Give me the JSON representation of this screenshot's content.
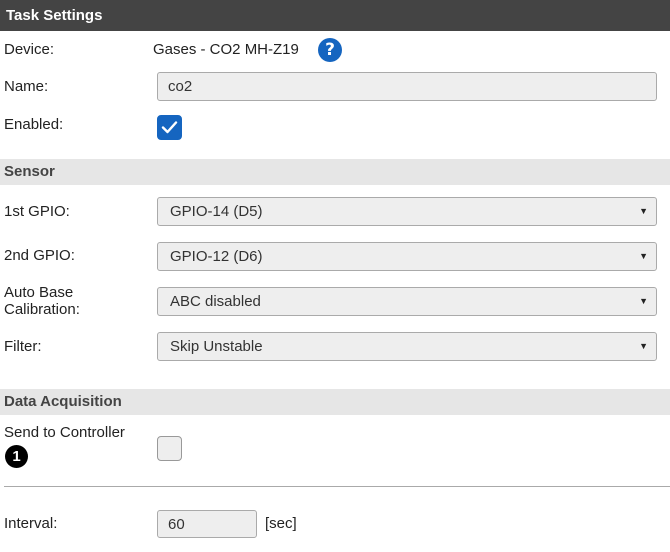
{
  "title": "Task Settings",
  "device": {
    "label": "Device:",
    "value": "Gases - CO2 MH-Z19",
    "help_icon": "?"
  },
  "name": {
    "label": "Name:",
    "value": "co2"
  },
  "enabled": {
    "label": "Enabled:",
    "checked": true
  },
  "sensor_section": {
    "title": "Sensor",
    "gpio1": {
      "label": "1st GPIO:",
      "selected": "GPIO-14 (D5)"
    },
    "gpio2": {
      "label": "2nd GPIO:",
      "selected": "GPIO-12 (D6)"
    },
    "abc": {
      "label_line1": "Auto Base",
      "label_line2": "Calibration:",
      "selected": "ABC disabled"
    },
    "filter": {
      "label": "Filter:",
      "selected": "Skip Unstable"
    }
  },
  "data_section": {
    "title": "Data Acquisition",
    "send_label": "Send to Controller",
    "controller_number": "1",
    "send_checked": false,
    "interval_label": "Interval:",
    "interval_value": "60",
    "interval_unit": "[sec]"
  },
  "icons": {
    "help": "help-icon",
    "check": "checkmark-icon",
    "dropdown": "dropdown-arrow-icon"
  },
  "colors": {
    "titlebar_bg": "#444444",
    "section_bg": "#e6e6e6",
    "accent": "#1565c0"
  }
}
